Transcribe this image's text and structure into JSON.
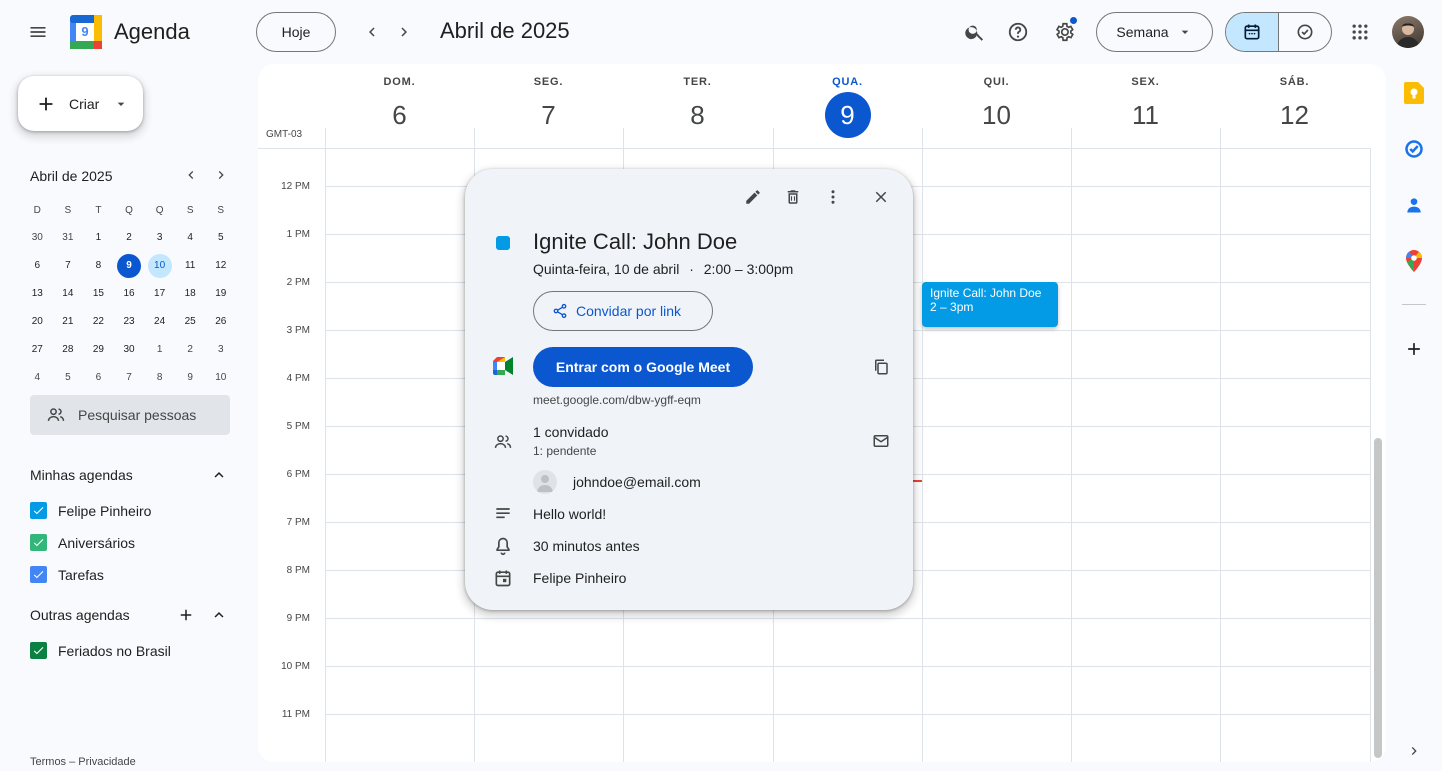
{
  "header": {
    "app_title": "Agenda",
    "logo_number": "9",
    "today_button": "Hoje",
    "current_period": "Abril de 2025",
    "view_selector": "Semana"
  },
  "sidebar": {
    "create_button": "Criar",
    "mini_calendar": {
      "title": "Abril de 2025",
      "weekday_headers": [
        "D",
        "S",
        "T",
        "Q",
        "Q",
        "S",
        "S"
      ],
      "weeks": [
        [
          "30",
          "31",
          "1",
          "2",
          "3",
          "4",
          "5"
        ],
        [
          "6",
          "7",
          "8",
          "9",
          "10",
          "11",
          "12"
        ],
        [
          "13",
          "14",
          "15",
          "16",
          "17",
          "18",
          "19"
        ],
        [
          "20",
          "21",
          "22",
          "23",
          "24",
          "25",
          "26"
        ],
        [
          "27",
          "28",
          "29",
          "30",
          "1",
          "2",
          "3"
        ],
        [
          "4",
          "5",
          "6",
          "7",
          "8",
          "9",
          "10"
        ]
      ]
    },
    "search_people": "Pesquisar pessoas",
    "my_calendars_title": "Minhas agendas",
    "my_calendars": [
      {
        "label": "Felipe Pinheiro",
        "color": "#039be5"
      },
      {
        "label": "Aniversários",
        "color": "#33b679"
      },
      {
        "label": "Tarefas",
        "color": "#4285f4"
      }
    ],
    "other_calendars_title": "Outras agendas",
    "other_calendars": [
      {
        "label": "Feriados no Brasil",
        "color": "#0b8043"
      }
    ],
    "footer": "Termos – Privacidade"
  },
  "week": {
    "timezone": "GMT-03",
    "days": [
      {
        "dow": "DOM.",
        "num": "6"
      },
      {
        "dow": "SEG.",
        "num": "7"
      },
      {
        "dow": "TER.",
        "num": "8"
      },
      {
        "dow": "QUA.",
        "num": "9"
      },
      {
        "dow": "QUI.",
        "num": "10"
      },
      {
        "dow": "SEX.",
        "num": "11"
      },
      {
        "dow": "SÁB.",
        "num": "12"
      }
    ],
    "hours": [
      "12 PM",
      "1 PM",
      "2 PM",
      "3 PM",
      "4 PM",
      "5 PM",
      "6 PM",
      "7 PM",
      "8 PM",
      "9 PM",
      "10 PM",
      "11 PM"
    ]
  },
  "event_chip": {
    "title": "Ignite Call: John Doe",
    "time": "2 – 3pm"
  },
  "popup": {
    "title": "Ignite Call: John Doe",
    "date": "Quinta-feira, 10 de abril",
    "separator": "·",
    "time": "2:00 – 3:00pm",
    "invite_link_button": "Convidar por link",
    "meet_button": "Entrar com o Google Meet",
    "meet_url": "meet.google.com/dbw-ygff-eqm",
    "guests_count": "1 convidado",
    "guests_status": "1: pendente",
    "guest_email": "johndoe@email.com",
    "description": "Hello world!",
    "reminder": "30 minutos antes",
    "calendar_owner": "Felipe Pinheiro",
    "event_color": "#039be5"
  },
  "colors": {
    "primary": "#0b57d0",
    "today_badge": "#0b57d0",
    "event": "#039be5",
    "now_line": "#ea4335"
  }
}
